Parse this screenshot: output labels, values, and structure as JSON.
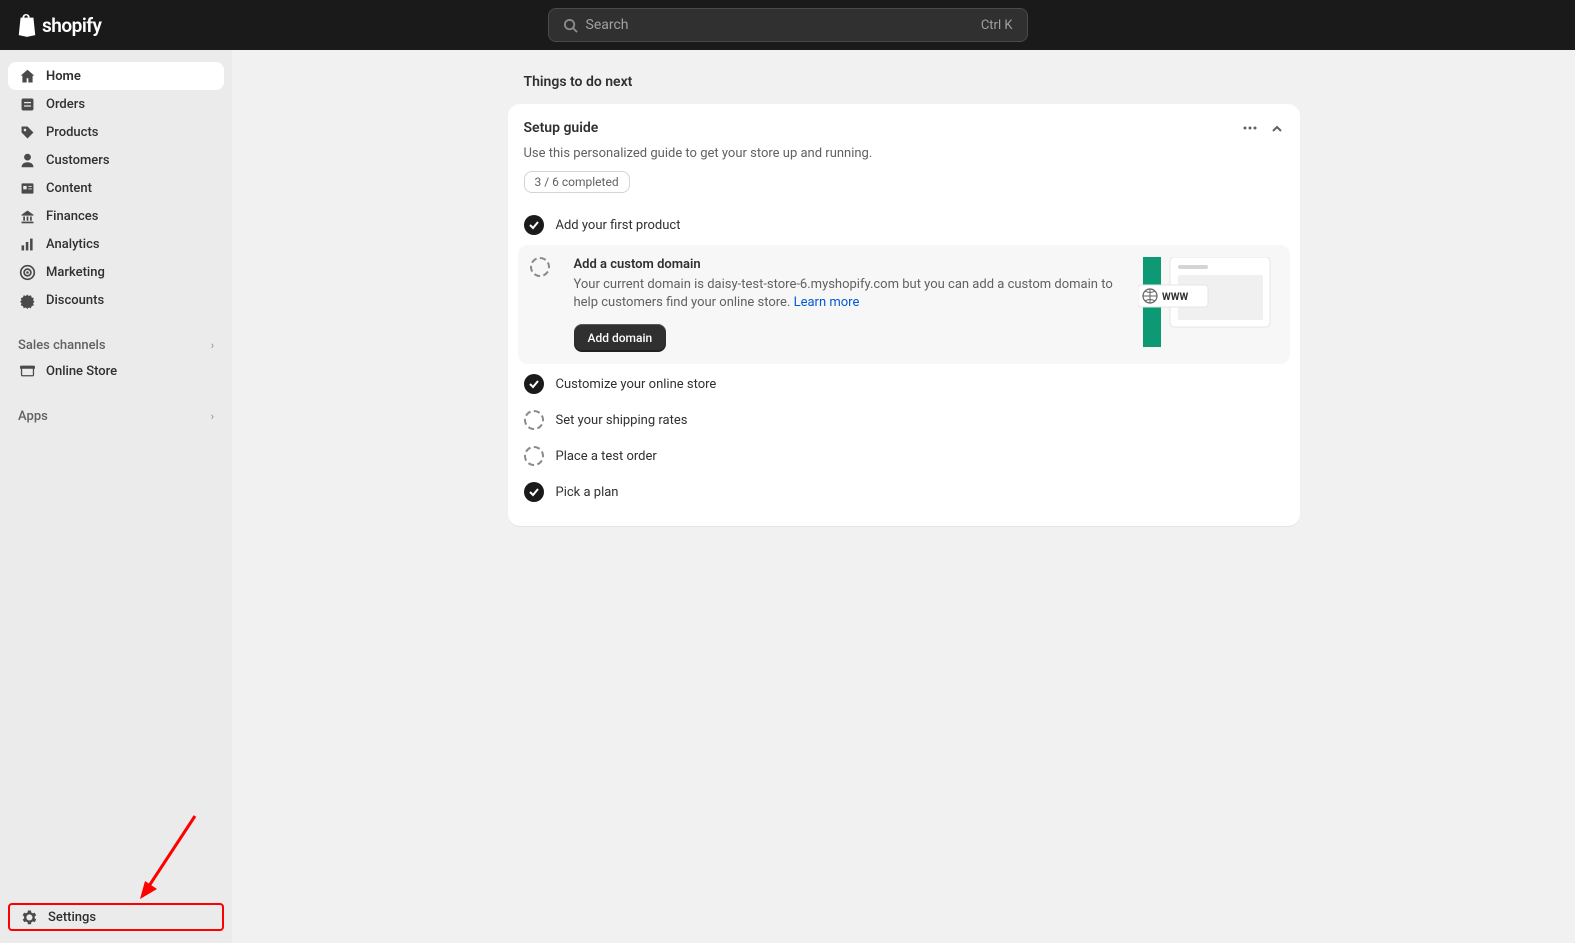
{
  "topbar": {
    "logo_text": "shopify",
    "search_placeholder": "Search",
    "search_shortcut": "Ctrl K"
  },
  "sidebar": {
    "items": [
      {
        "label": "Home",
        "icon": "home-icon"
      },
      {
        "label": "Orders",
        "icon": "orders-icon"
      },
      {
        "label": "Products",
        "icon": "products-icon"
      },
      {
        "label": "Customers",
        "icon": "customers-icon"
      },
      {
        "label": "Content",
        "icon": "content-icon"
      },
      {
        "label": "Finances",
        "icon": "finances-icon"
      },
      {
        "label": "Analytics",
        "icon": "analytics-icon"
      },
      {
        "label": "Marketing",
        "icon": "marketing-icon"
      },
      {
        "label": "Discounts",
        "icon": "discounts-icon"
      }
    ],
    "sales_channels_label": "Sales channels",
    "online_store_label": "Online Store",
    "apps_label": "Apps",
    "settings_label": "Settings"
  },
  "main": {
    "page_title": "Things to do next",
    "setup": {
      "title": "Setup guide",
      "subtitle": "Use this personalized guide to get your store up and running.",
      "progress": "3 / 6 completed",
      "tasks": {
        "add_product": "Add your first product",
        "custom_domain": {
          "title": "Add a custom domain",
          "desc": "Your current domain is daisy-test-store-6.myshopify.com but you can add a custom domain to help customers find your online store. ",
          "learn_more": "Learn more",
          "button": "Add domain",
          "www_label": "WWW"
        },
        "customize": "Customize your online store",
        "shipping": "Set your shipping rates",
        "test_order": "Place a test order",
        "pick_plan": "Pick a plan"
      }
    }
  }
}
